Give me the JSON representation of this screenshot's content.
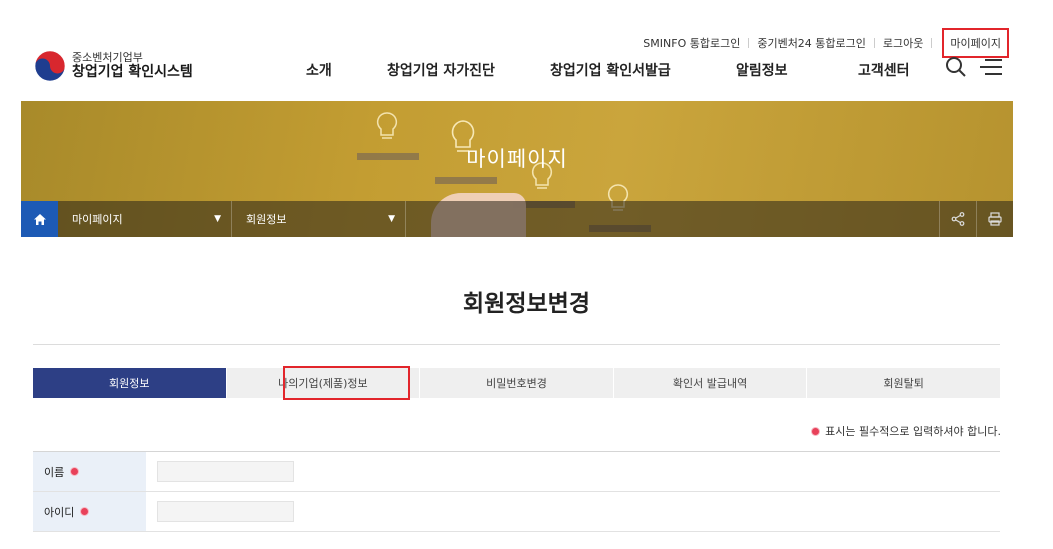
{
  "top_links": [
    "SMINFO 통합로그인",
    "중기벤처24 통합로그인",
    "로그아웃"
  ],
  "top_mypage": "마이페이지",
  "logo": {
    "line1": "중소벤처기업부",
    "line2": "창업기업 확인시스템"
  },
  "gnb": [
    "소개",
    "창업기업 자가진단",
    "창업기업 확인서발급",
    "알림정보",
    "고객센터"
  ],
  "banner": {
    "title": "마이페이지"
  },
  "location": {
    "item1": "마이페이지",
    "item2": "회원정보"
  },
  "page_title": "회원정보변경",
  "tabs": [
    "회원정보",
    "나의기업(제품)정보",
    "비밀번호변경",
    "확인서 발급내역",
    "회원탈퇴"
  ],
  "required_note": "표시는 필수적으로 입력하셔야 합니다.",
  "form": {
    "rows": [
      {
        "label": "이름",
        "value": ""
      },
      {
        "label": "아이디",
        "value": ""
      }
    ]
  },
  "colors": {
    "accent_navy": "#2d3f85",
    "highlight_red": "#e2252b",
    "required_dot": "#e8415a",
    "home_blue": "#1d5ab5"
  }
}
